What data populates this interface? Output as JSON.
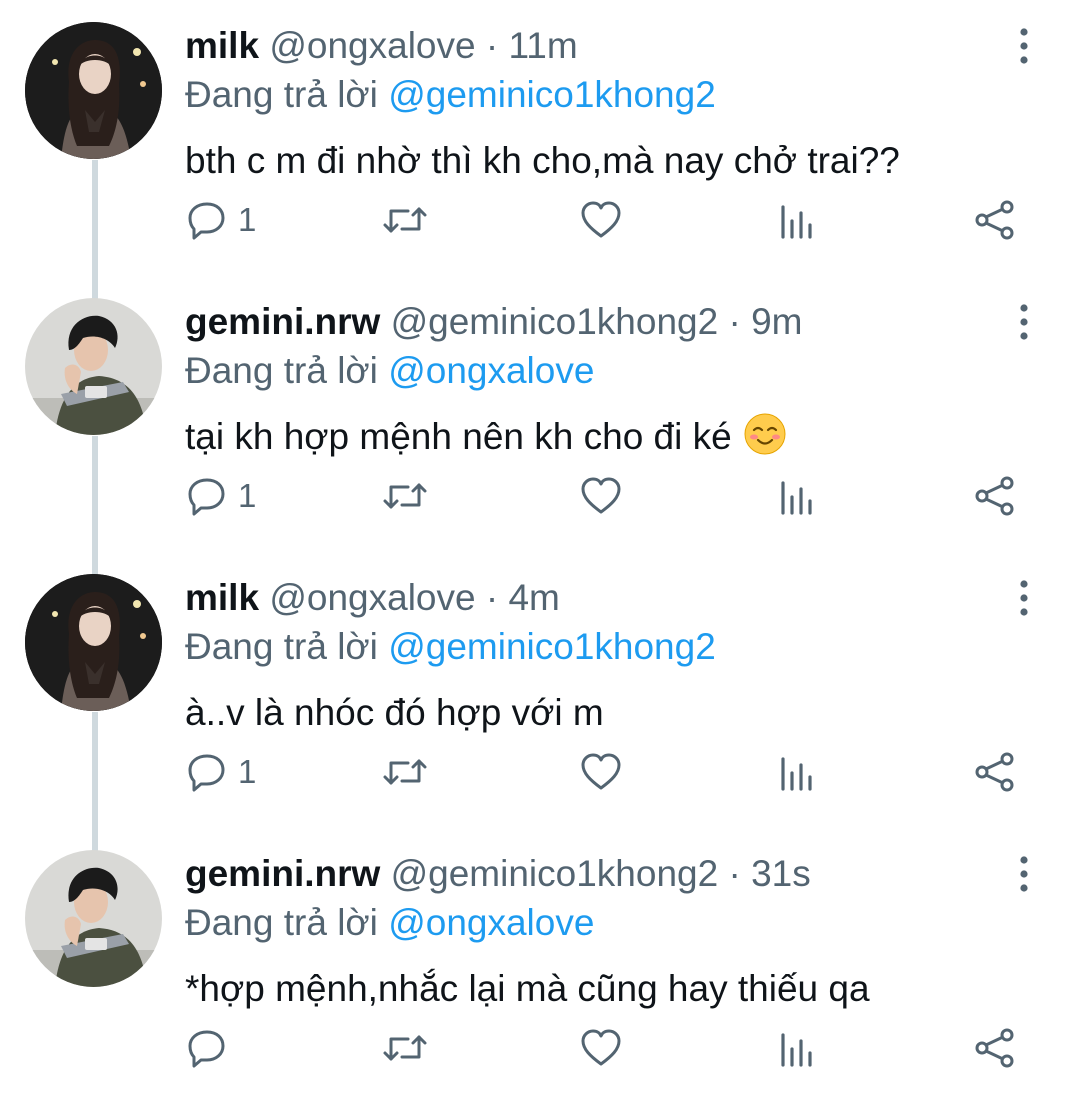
{
  "tweets": [
    {
      "name": "milk",
      "handle": "@ongxalove",
      "sep": " · ",
      "time": "11m",
      "replying_prefix": "Đang trả lời ",
      "replying_to": "@geminico1khong2",
      "text": "bth c m đi nhờ thì kh cho,mà nay chở trai??",
      "emoji": "",
      "reply_count": "1",
      "avatar": "female-avatar"
    },
    {
      "name": "gemini.nrw",
      "handle": "@geminico1khong2",
      "sep": " · ",
      "time": "9m",
      "replying_prefix": "Đang trả lời ",
      "replying_to": "@ongxalove",
      "text": "tại kh hợp mệnh nên kh cho đi ké",
      "emoji": "smiling-blush-emoji",
      "reply_count": "1",
      "avatar": "male-avatar"
    },
    {
      "name": "milk",
      "handle": "@ongxalove",
      "sep": " · ",
      "time": "4m",
      "replying_prefix": "Đang trả lời ",
      "replying_to": "@geminico1khong2",
      "text": "à..v là nhóc đó hợp với m",
      "emoji": "",
      "reply_count": "1",
      "avatar": "female-avatar"
    },
    {
      "name": "gemini.nrw",
      "handle": "@geminico1khong2",
      "sep": " · ",
      "time": "31s",
      "replying_prefix": "Đang trả lời ",
      "replying_to": "@ongxalove",
      "text": "*hợp mệnh,nhắc lại mà cũng hay thiếu qa",
      "emoji": "",
      "reply_count": "",
      "avatar": "male-avatar"
    }
  ],
  "icons": {
    "reply": "reply-icon",
    "retweet": "retweet-icon",
    "like": "heart-icon",
    "views": "views-icon",
    "share": "share-icon",
    "more": "more-vertical-icon"
  },
  "colors": {
    "link": "#1d9bf0",
    "secondary": "#536471",
    "thread_line": "#cfd9de",
    "text": "#0f1419"
  }
}
